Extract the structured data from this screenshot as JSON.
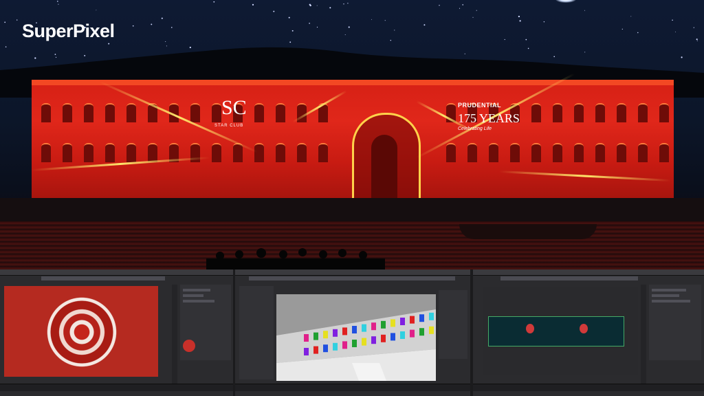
{
  "brand": {
    "logo_text": "SuperPixel"
  },
  "projection": {
    "left_logo": {
      "monogram": "SC",
      "caption": "STAR CLUB"
    },
    "right_logo": {
      "name": "PRUDENTIAL",
      "years": "175 YEARS",
      "tagline": "Celebrating Life"
    }
  },
  "colors": {
    "facade_red": "#e0271a",
    "beam_yellow": "#ffe66a",
    "sky": "#0e1a33",
    "ui_dark": "#2b2b2e"
  },
  "panels": [
    {
      "name": "compositing-app",
      "viewport": "red-mandala-render"
    },
    {
      "name": "3d-modeling-app",
      "viewport": "white-building-model"
    },
    {
      "name": "3d-preview-app",
      "viewport": "facade-mesh-preview"
    }
  ]
}
